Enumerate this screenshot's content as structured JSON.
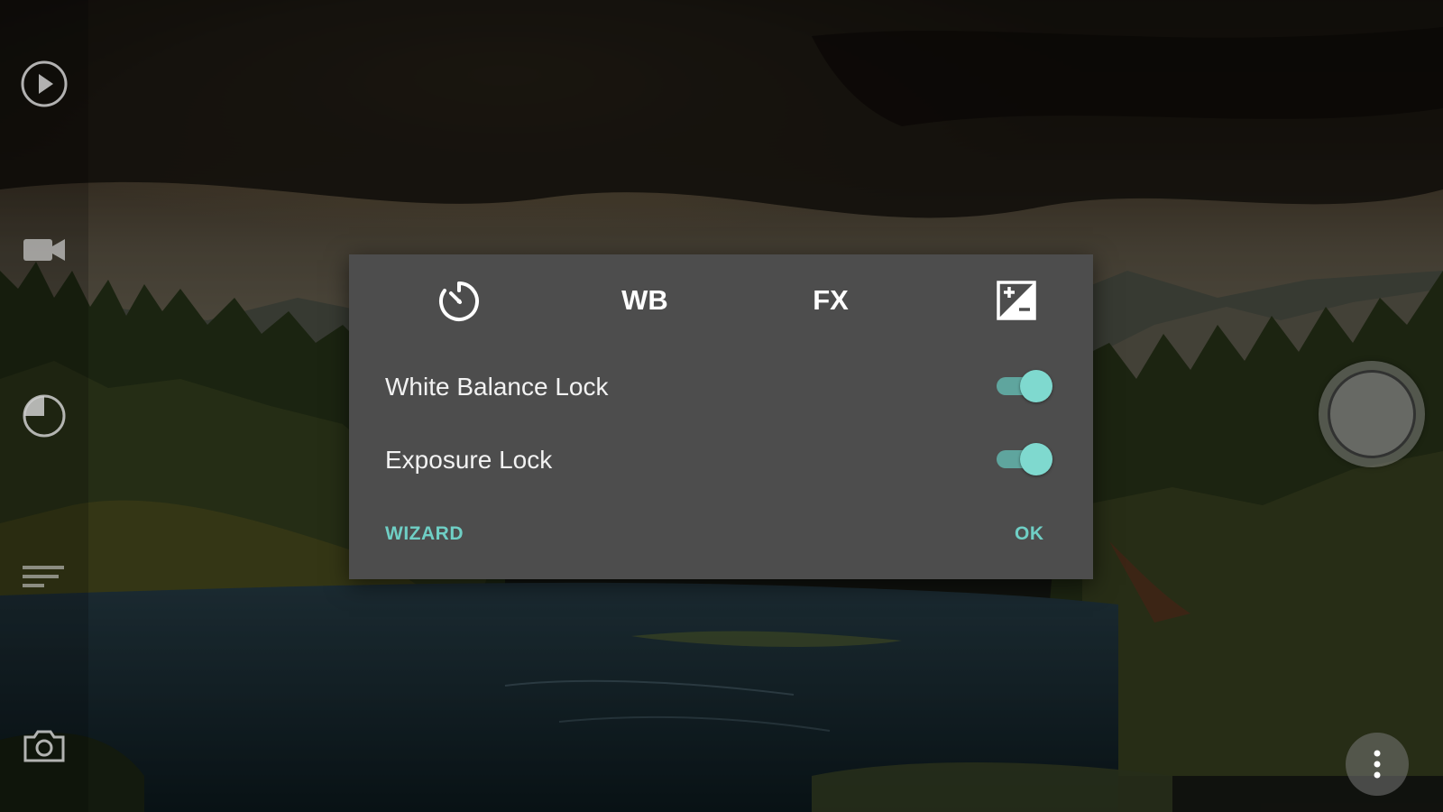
{
  "left_rail": {
    "icons": [
      "play-icon",
      "video-camera-icon",
      "pie-icon",
      "list-icon",
      "camera-icon"
    ]
  },
  "dialog": {
    "tabs": [
      {
        "id": "timer",
        "label": "",
        "icon": "timer-icon"
      },
      {
        "id": "wb",
        "label": "WB"
      },
      {
        "id": "fx",
        "label": "FX"
      },
      {
        "id": "exposure",
        "label": "",
        "icon": "exposure-plus-minus-icon"
      }
    ],
    "settings": [
      {
        "label": "White Balance Lock",
        "enabled": true
      },
      {
        "label": "Exposure Lock",
        "enabled": true
      }
    ],
    "buttons": {
      "wizard": "WIZARD",
      "ok": "OK"
    }
  },
  "colors": {
    "accent": "#6fcfc5",
    "dialog_bg": "#4d4d4d",
    "toggle_thumb": "#7fd9cf",
    "toggle_track": "#5fa59e"
  },
  "shutter": {
    "icon": "shutter-button"
  },
  "more": {
    "icon": "more-vertical-icon"
  }
}
